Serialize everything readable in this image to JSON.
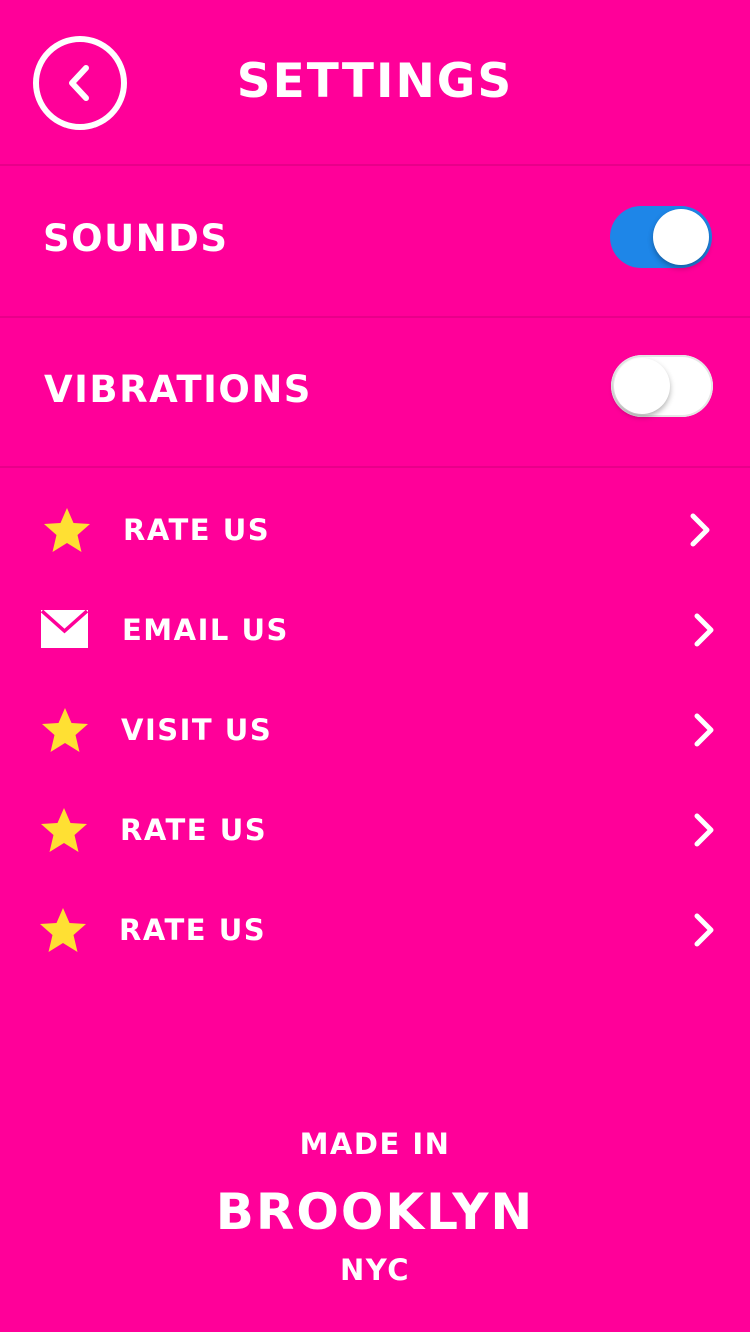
{
  "header": {
    "title": "SETTINGS",
    "back_icon": "chevron-left-icon"
  },
  "toggles": [
    {
      "label": "SOUNDS",
      "state": "on"
    },
    {
      "label": "VIBRATIONS",
      "state": "off"
    }
  ],
  "menu": {
    "items": [
      {
        "label": "RATE US",
        "icon": "star-icon"
      },
      {
        "label": "EMAIL US",
        "icon": "envelope-icon"
      },
      {
        "label": "VISIT US",
        "icon": "star-icon"
      },
      {
        "label": "RATE US",
        "icon": "star-icon"
      },
      {
        "label": "RATE US",
        "icon": "star-icon"
      }
    ]
  },
  "footer": {
    "line1": "MADE IN",
    "line2": "BROOKLYN",
    "line3": "NYC"
  },
  "colors": {
    "background": "#FF0099",
    "toggle_on": "#1E86E8",
    "star": "#FFE033",
    "text": "#FFFFFF"
  }
}
